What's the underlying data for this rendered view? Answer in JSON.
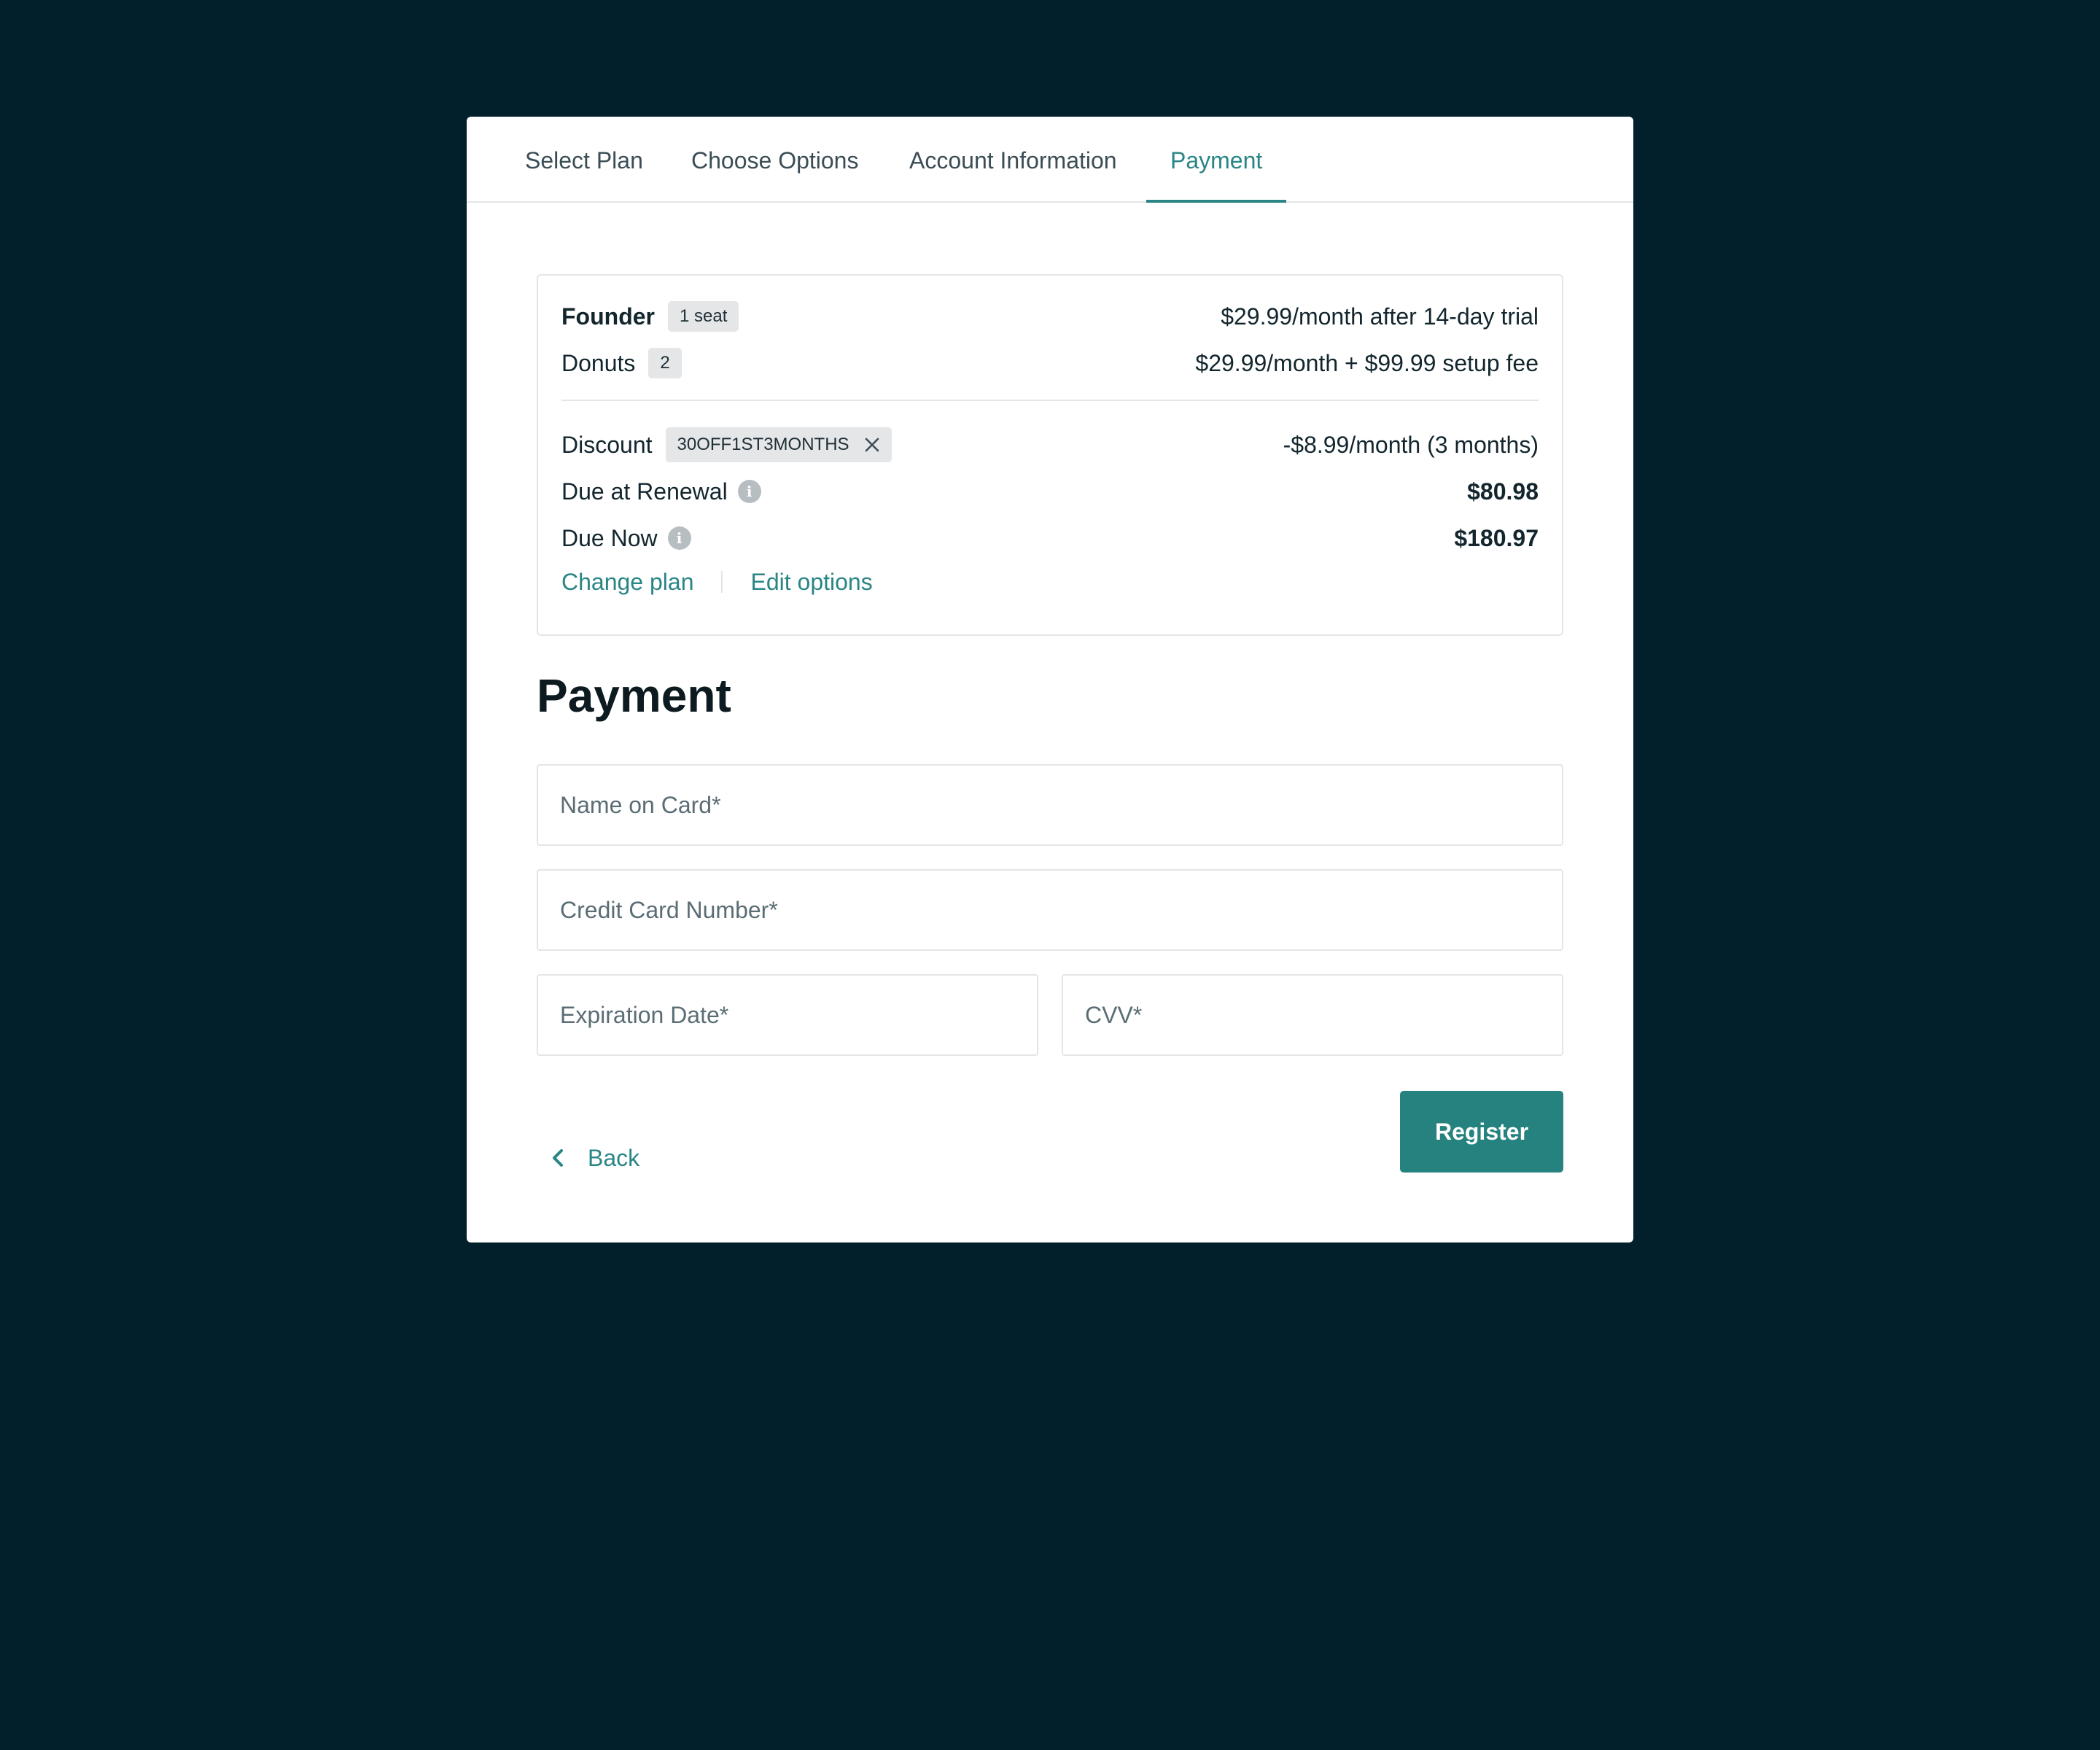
{
  "tabs": [
    {
      "label": "Select Plan"
    },
    {
      "label": "Choose Options"
    },
    {
      "label": "Account Information"
    },
    {
      "label": "Payment"
    }
  ],
  "active_tab": "Payment",
  "summary": {
    "plan": {
      "name": "Founder",
      "badge": "1 seat",
      "price": "$29.99/month after 14-day trial"
    },
    "addon": {
      "name": "Donuts",
      "badge": "2",
      "price": "$29.99/month + $99.99 setup fee"
    },
    "discount": {
      "label": "Discount",
      "code": "30OFF1ST3MONTHS",
      "amount": "-$8.99/month (3 months)"
    },
    "renewal": {
      "label": "Due at Renewal",
      "amount": "$80.98"
    },
    "due_now": {
      "label": "Due Now",
      "amount": "$180.97"
    },
    "links": {
      "change_plan": "Change plan",
      "edit_options": "Edit options"
    }
  },
  "payment": {
    "title": "Payment",
    "name_on_card": {
      "placeholder": "Name on Card*",
      "value": ""
    },
    "card_number": {
      "placeholder": "Credit Card Number*",
      "value": ""
    },
    "expiration": {
      "placeholder": "Expiration Date*",
      "value": ""
    },
    "cvv": {
      "placeholder": "CVV*",
      "value": ""
    }
  },
  "actions": {
    "back_label": "Back",
    "register_label": "Register"
  },
  "colors": {
    "background": "#01202b",
    "accent": "#2a8585",
    "button": "#25827f"
  },
  "icons": {
    "info": "info-icon",
    "remove_coupon": "close-icon",
    "back": "chevron-left-icon"
  }
}
